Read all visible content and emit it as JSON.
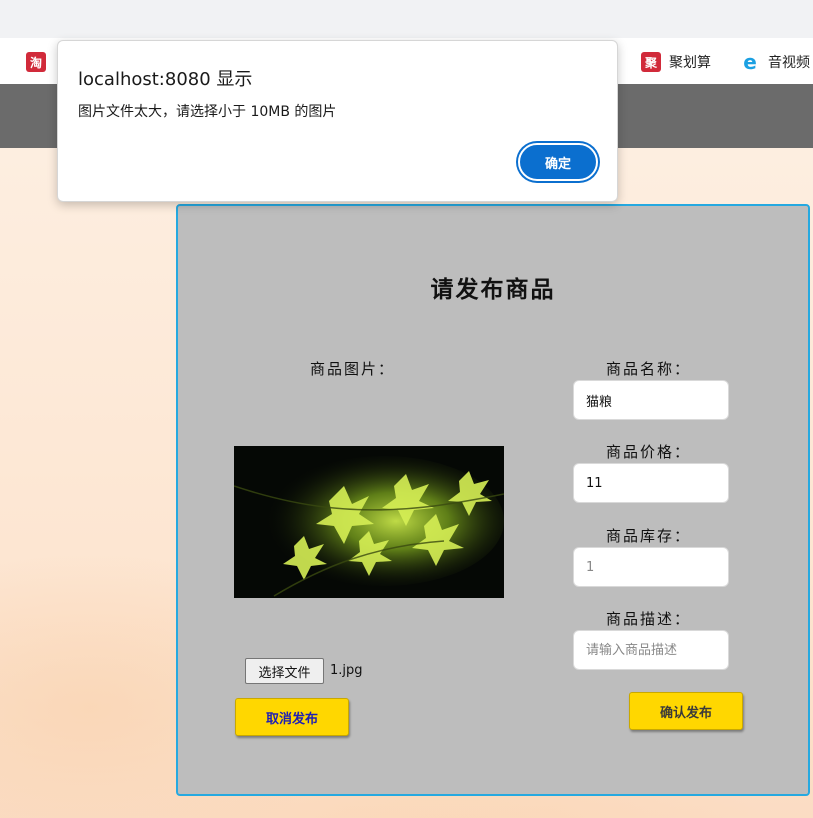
{
  "browser": {
    "bookmarks": [
      {
        "label": "聚划算",
        "icon": "juhuasuan-icon",
        "icon_glyph": "聚"
      },
      {
        "label": "音视频",
        "icon": "ie-icon",
        "icon_glyph": "e"
      }
    ],
    "left_bookmark_icon_glyph": "淘"
  },
  "dialog": {
    "title": "localhost:8080 显示",
    "message": "图片文件太大，请选择小于 10MB 的图片",
    "ok_label": "确定"
  },
  "form": {
    "title": "请发布商品",
    "image_label": "商品图片：",
    "name_label": "商品名称：",
    "name_value": "猫粮",
    "price_label": "商品价格：",
    "price_value": "11",
    "stock_label": "商品库存：",
    "stock_placeholder": "1",
    "desc_label": "商品描述：",
    "desc_placeholder": "请输入商品描述",
    "file_button_label": "选择文件",
    "file_name": "1.jpg",
    "cancel_label": "取消发布",
    "confirm_label": "确认发布"
  },
  "colors": {
    "card_background": "#bdbdbd",
    "card_border": "#26a9e0",
    "button_yellow": "#ffd700",
    "dialog_button": "#0b6fcf",
    "nav_bar": "#6b6b6b"
  }
}
